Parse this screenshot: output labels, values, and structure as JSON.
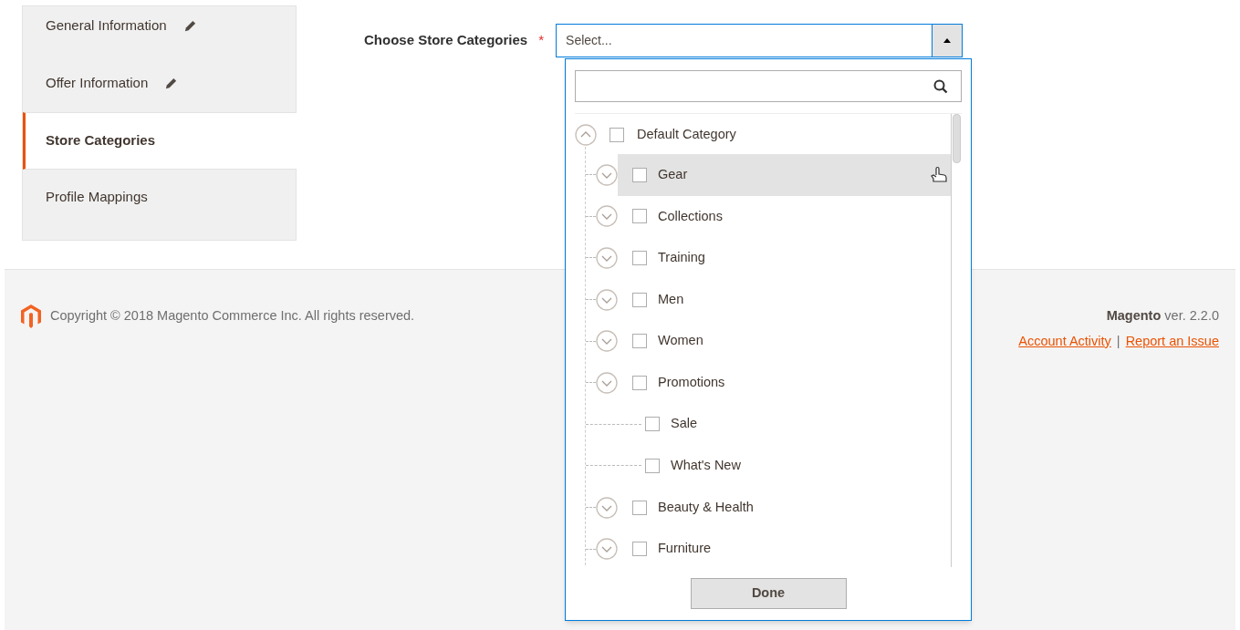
{
  "sidebar": {
    "items": [
      {
        "label": "General Information",
        "selected": false,
        "edited": true
      },
      {
        "label": "Offer Information",
        "selected": false,
        "edited": true
      },
      {
        "label": "Store Categories",
        "selected": true,
        "edited": false
      },
      {
        "label": "Profile Mappings",
        "selected": false,
        "edited": false
      }
    ]
  },
  "field": {
    "label": "Choose Store Categories",
    "required_mark": "*",
    "placeholder": "Select...",
    "open": true
  },
  "dropdown": {
    "tree": [
      {
        "label": "Default Category",
        "kind": "branch",
        "expanded": true,
        "checked": false,
        "highlighted": false,
        "children": [
          {
            "label": "Gear",
            "kind": "branch",
            "expanded": false,
            "checked": false,
            "highlighted": true
          },
          {
            "label": "Collections",
            "kind": "branch",
            "expanded": false,
            "checked": false,
            "highlighted": false
          },
          {
            "label": "Training",
            "kind": "branch",
            "expanded": false,
            "checked": false,
            "highlighted": false
          },
          {
            "label": "Men",
            "kind": "branch",
            "expanded": false,
            "checked": false,
            "highlighted": false
          },
          {
            "label": "Women",
            "kind": "branch",
            "expanded": false,
            "checked": false,
            "highlighted": false
          },
          {
            "label": "Promotions",
            "kind": "branch",
            "expanded": false,
            "checked": false,
            "highlighted": false
          },
          {
            "label": "Sale",
            "kind": "leaf",
            "checked": false,
            "highlighted": false
          },
          {
            "label": "What's New",
            "kind": "leaf",
            "checked": false,
            "highlighted": false
          },
          {
            "label": "Beauty & Health",
            "kind": "branch",
            "expanded": false,
            "checked": false,
            "highlighted": false
          },
          {
            "label": "Furniture",
            "kind": "branch",
            "expanded": false,
            "checked": false,
            "highlighted": false
          }
        ]
      }
    ],
    "done_button": "Done"
  },
  "footer": {
    "copyright": "Copyright © 2018 Magento Commerce Inc. All rights reserved.",
    "version": "**Magento** ver. 2.2.0",
    "links": [
      "Account Activity",
      "Report an Issue"
    ],
    "separator": "|"
  }
}
